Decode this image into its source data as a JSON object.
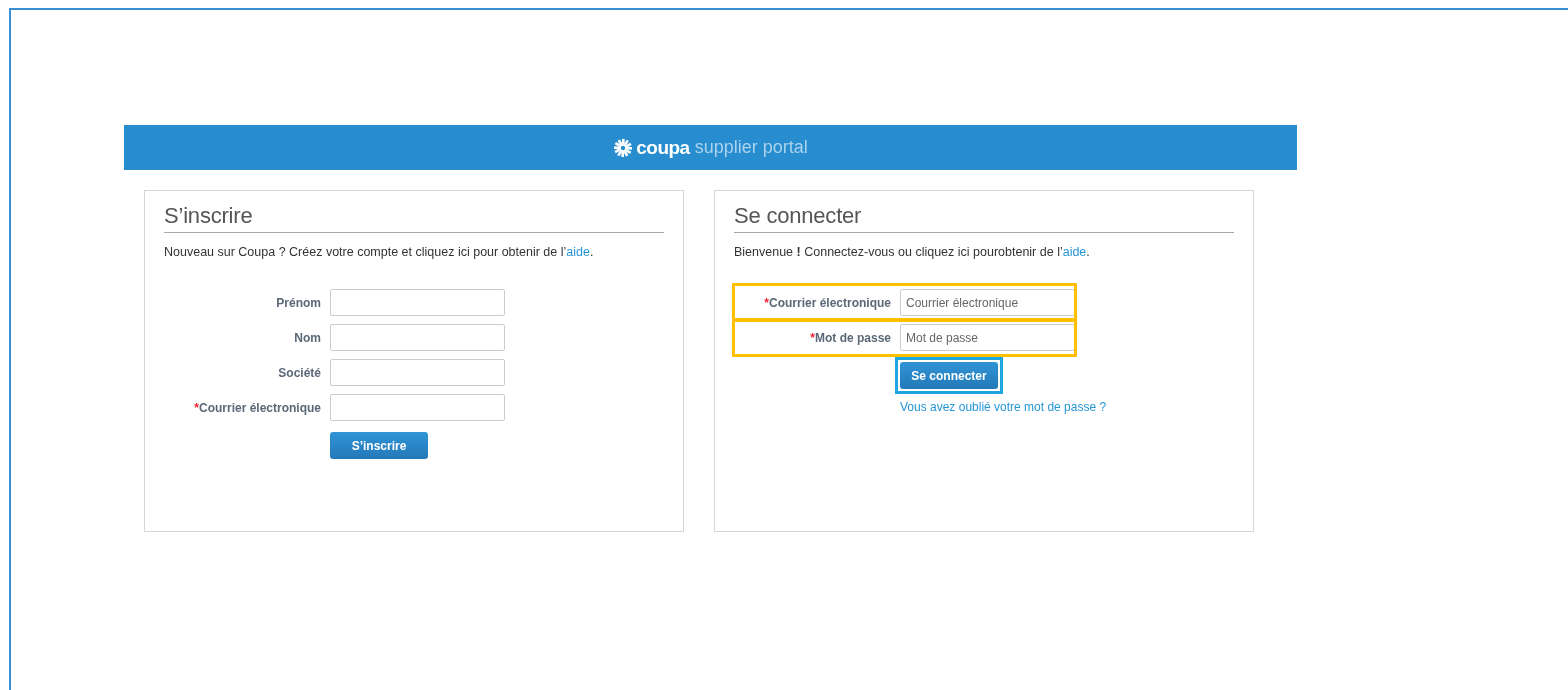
{
  "header": {
    "logo_bold": "coupa",
    "logo_light": "supplier portal"
  },
  "panels": [
    {
      "title": "S’inscrire",
      "intro": "Nouveau sur Coupa ? Créez votre compte et cliquez ici pour obtenir de l’",
      "intro_link": "aide",
      "intro_end": ".",
      "fields": [
        {
          "label": "Prénom"
        },
        {
          "label": "Nom"
        },
        {
          "label": "Société"
        },
        {
          "label": "Courrier électronique",
          "required_mark": "*"
        }
      ],
      "button": {
        "label": "S’inscrire"
      }
    },
    {
      "title": "Se connecter",
      "intro": "Bienvenue **!** Connectez-vous ou cliquez ici pourobtenir de l’",
      "intro_link": "aide",
      "intro_end": ".",
      "fields": [
        {
          "label": "Courrier électronique",
          "required_mark": "*",
          "placeholder": "Courrier électronique",
          "highlighted": true
        },
        {
          "label": "Mot de passe",
          "required_mark": "*",
          "placeholder": "Mot de passe",
          "highlighted": true
        }
      ],
      "button": {
        "label": "Se connecter",
        "highlighted": true
      },
      "footer_link": "Vous avez oublié votre mot de passe ?"
    }
  ]
}
